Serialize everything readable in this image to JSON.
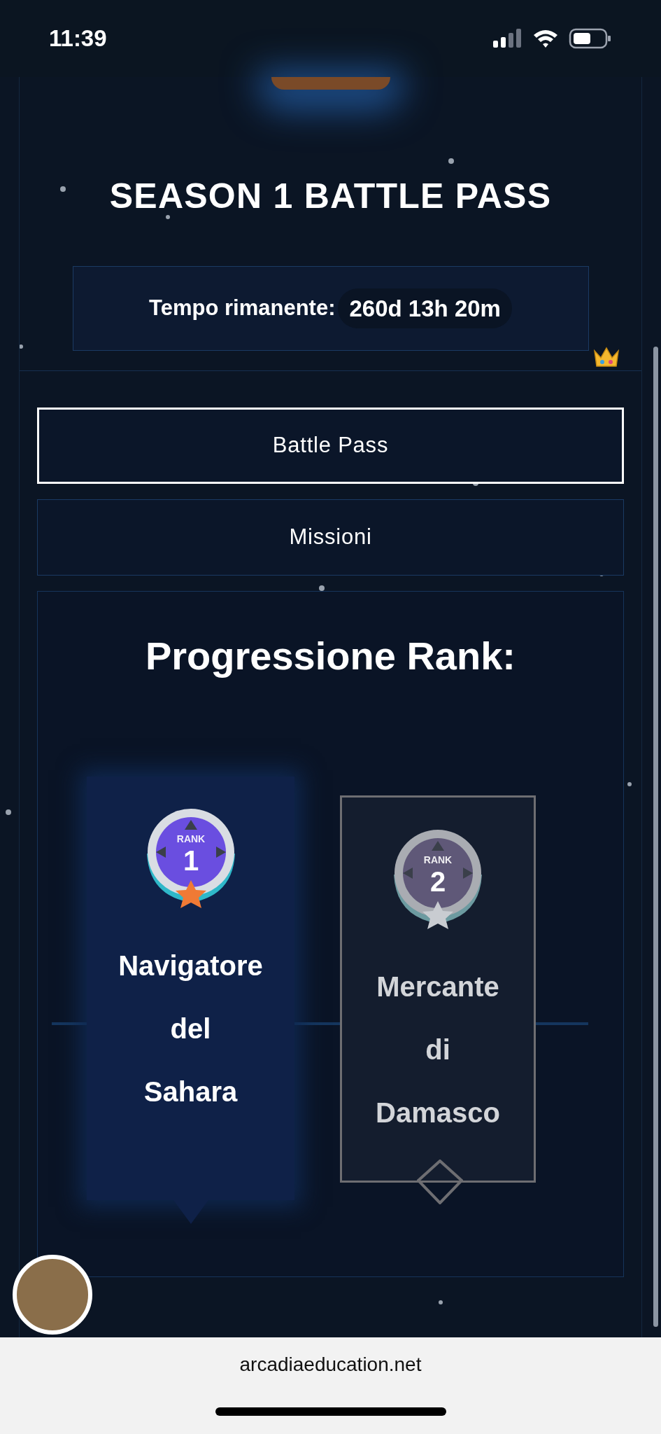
{
  "status_bar": {
    "time": "11:39"
  },
  "title": "SEASON 1 BATTLE PASS",
  "timer": {
    "label": "Tempo rimanente:",
    "value": "260d 13h 20m"
  },
  "tabs": [
    {
      "label": "Battle Pass",
      "selected": true
    },
    {
      "label": "Missioni",
      "selected": false
    }
  ],
  "progression": {
    "title": "Progressione Rank:",
    "ranks": [
      {
        "badge_label": "RANK",
        "badge_number": "1",
        "name_lines": [
          "Navigatore",
          "del",
          "Sahara"
        ],
        "selected": true,
        "unlocked": true
      },
      {
        "badge_label": "RANK",
        "badge_number": "2",
        "name_lines": [
          "Mercante",
          "di",
          "Damasco"
        ],
        "selected": false,
        "unlocked": false
      }
    ]
  },
  "browser": {
    "url": "arcadiaeducation.net"
  }
}
